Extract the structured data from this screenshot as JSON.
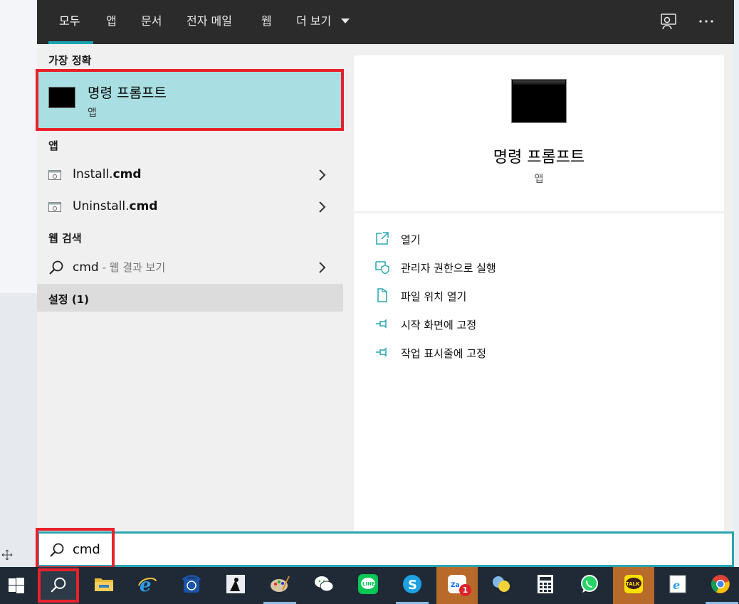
{
  "tabs": [
    {
      "label": "모두",
      "active": true
    },
    {
      "label": "앱"
    },
    {
      "label": "문서"
    },
    {
      "label": "전자 메일"
    },
    {
      "label": "웹"
    },
    {
      "label": "더 보기"
    }
  ],
  "sections": {
    "best_match": "가장 정확",
    "apps": "앱",
    "web_search": "웹 검색"
  },
  "best_match": {
    "title": "명령 프롬프트",
    "subtitle": "앱"
  },
  "apps": [
    {
      "name": "Install.",
      "ext": "cmd"
    },
    {
      "name": "Uninstall.",
      "ext": "cmd"
    }
  ],
  "web_search": {
    "query": "cmd",
    "hint": " - 웹 결과 보기"
  },
  "settings": {
    "label": "설정 (1)"
  },
  "preview": {
    "title": "명령 프롬프트",
    "subtitle": "앱",
    "actions": [
      "열기",
      "관리자 권한으로 실행",
      "파일 위치 열기",
      "시작 화면에 고정",
      "작업 표시줄에 고정"
    ]
  },
  "search": {
    "value": "cmd"
  },
  "taskbar": {
    "items": [
      "windows-start",
      "search",
      "file-explorer",
      "internet-explorer",
      "phone-app",
      "kindle",
      "paint",
      "wechat",
      "line",
      "skype",
      "zalo",
      "chat-bubbles",
      "calculator",
      "whatsapp",
      "kakaotalk",
      "ie-page",
      "chrome"
    ],
    "zalo_badge": "1",
    "kakao_label": "TALK"
  },
  "colors": {
    "accent": "#2aa5b0",
    "selection": "#a9dfe3",
    "highlight_box": "#e8212b",
    "taskbar": "#1f2a36"
  }
}
